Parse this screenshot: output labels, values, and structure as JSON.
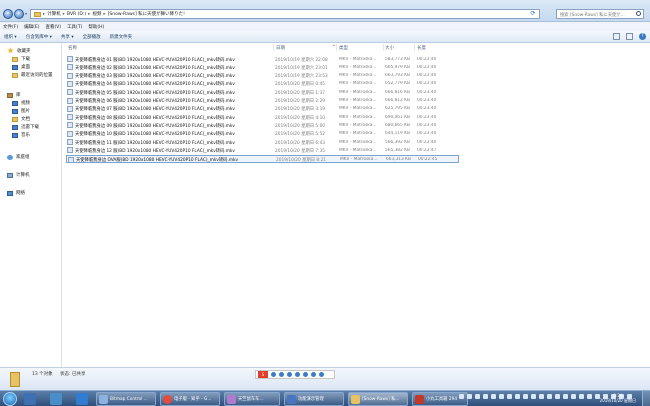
{
  "address": {
    "crumbs": [
      "计算机",
      "BVR (D:)",
      "视频",
      "[Snow-Raws] 私に天使が舞い降りた!"
    ],
    "search_placeholder": "搜索 [Snow-Raws] 私に天使が..."
  },
  "menu": [
    "文件(F)",
    "编辑(E)",
    "查看(V)",
    "工具(T)",
    "帮助(H)"
  ],
  "toolbar": {
    "organize": "组织 ▾",
    "include": "包含到库中 ▾",
    "share": "共享 ▾",
    "play_all": "全部播放",
    "new_folder": "新建文件夹"
  },
  "sidebar": {
    "favorites": "收藏夹",
    "downloads": "下载",
    "desktop": "桌面",
    "recent": "最近访问的位置",
    "libraries": "库",
    "videos": "视频",
    "pictures": "图片",
    "documents": "文档",
    "xunlei": "迅雷下载",
    "music": "音乐",
    "homegroup": "家庭组",
    "computer": "计算机",
    "network": "网络"
  },
  "columns": {
    "name": "名称",
    "date": "日期",
    "type": "类型",
    "size": "大小",
    "duration": "长度"
  },
  "files": [
    {
      "name": "天使降临我身边 01 服(BD 1920x1080 HEVC-YUV420P10 FLAC)_mkv转码.mkv",
      "date": "2019/10/19 星期六 22:08",
      "type": "MKV - Matroska...",
      "size": "583,773 KB",
      "duration": "00:23:40"
    },
    {
      "name": "天使降临我身边 02 服(BD 1920x1080 HEVC-YUV420P10 FLAC)_mkv转码.mkv",
      "date": "2019/10/19 星期六 23:01",
      "type": "MKV - Matroska...",
      "size": "665,979 KB",
      "duration": "00:23:40"
    },
    {
      "name": "天使降临我身边 03 服(BD 1920x1080 HEVC-YUV420P10 FLAC)_mkv转码.mkv",
      "date": "2019/10/19 星期六 23:53",
      "type": "MKV - Matroska...",
      "size": "663,793 KB",
      "duration": "00:23:40"
    },
    {
      "name": "天使降临我身边 04 服(BD 1920x1080 HEVC-YUV420P10 FLAC)_mkv转码.mkv",
      "date": "2019/10/20 星期日 0:45",
      "type": "MKV - Matroska...",
      "size": "652,779 KB",
      "duration": "00:23:40"
    },
    {
      "name": "天使降临我身边 05 服(BD 1920x1080 HEVC-YUV420P10 FLAC)_mkv转码.mkv",
      "date": "2019/10/20 星期日 1:37",
      "type": "MKV - Matroska...",
      "size": "666,816 KB",
      "duration": "00:23:40"
    },
    {
      "name": "天使降临我身边 06 服(BD 1920x1080 HEVC-YUV420P10 FLAC)_mkv转码.mkv",
      "date": "2019/10/20 星期日 2:29",
      "type": "MKV - Matroska...",
      "size": "666,812 KB",
      "duration": "00:23:40"
    },
    {
      "name": "天使降临我身边 07 服(BD 1920x1080 HEVC-YUV420P10 FLAC)_mkv转码.mkv",
      "date": "2019/10/20 星期日 3:19",
      "type": "MKV - Matroska...",
      "size": "625,795 KB",
      "duration": "00:23:40"
    },
    {
      "name": "天使降临我身边 08 服(BD 1920x1080 HEVC-YUV420P10 FLAC)_mkv转码.mkv",
      "date": "2019/10/20 星期日 4:10",
      "type": "MKV - Matroska...",
      "size": "690,061 KB",
      "duration": "00:23:40"
    },
    {
      "name": "天使降临我身边 09 服(BD 1920x1080 HEVC-YUV420P10 FLAC)_mkv转码.mkv",
      "date": "2019/10/20 星期日 5:00",
      "type": "MKV - Matroska...",
      "size": "680,665 KB",
      "duration": "00:23:40"
    },
    {
      "name": "天使降临我身边 10 服(BD 1920x1080 HEVC-YUV420P10 FLAC)_mkv转码.mkv",
      "date": "2019/10/20 星期日 5:52",
      "type": "MKV - Matroska...",
      "size": "644,119 KB",
      "duration": "00:23:40"
    },
    {
      "name": "天使降临我身边 11 服(BD 1920x1080 HEVC-YUV420P10 FLAC)_mkv转码.mkv",
      "date": "2019/10/20 星期日 6:43",
      "type": "MKV - Matroska...",
      "size": "566,392 KB",
      "duration": "00:23:40"
    },
    {
      "name": "天使降临我身边 12 服(BD 1920x1080 HEVC-YUV420P10 FLAC)_mkv转码.mkv",
      "date": "2019/10/20 星期日 7:35",
      "type": "MKV - Matroska...",
      "size": "565,382 KB",
      "duration": "00:23:47"
    },
    {
      "name": "天使降临我身边 OVA服(BD 1920x1080 HEVC-YUV420P10 FLAC)_mkv转码.mkv",
      "date": "2019/10/20 星期日 8:21",
      "type": "MKV - Matroska...",
      "size": "663,313 KB",
      "duration": "00:22:45"
    }
  ],
  "details": {
    "count": "13 个对象",
    "state": "状态: 已共享"
  },
  "taskbar": {
    "tasks": [
      "Bitmap Control ...",
      "电子版 - 知乎 - G...",
      "天竺鼠车车...",
      "功能演示管理",
      "[Snow-Raws] 私...",
      "小丸工具箱 294"
    ],
    "time": "9:24",
    "date": "2019/10/20 星期日"
  }
}
